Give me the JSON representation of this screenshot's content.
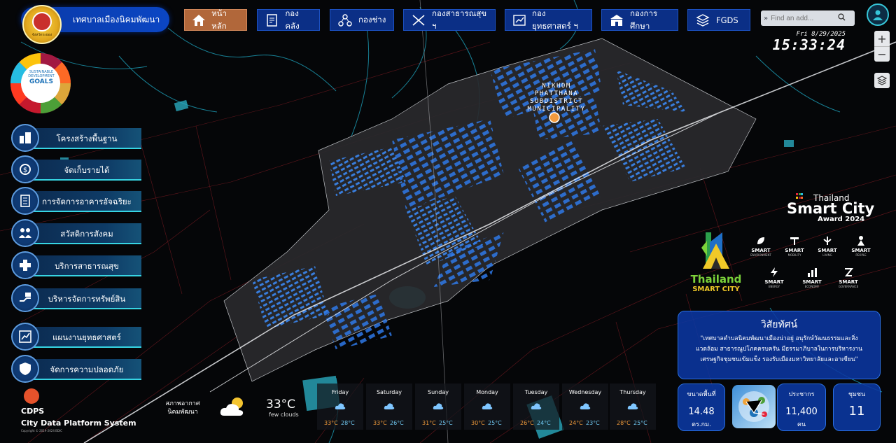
{
  "header": {
    "org_name": "เทศบาลเมืองนิคมพัฒนา",
    "logo_caption": "จังหวัดระยอง",
    "nav": [
      {
        "label": "หน้าหลัก",
        "icon": "home-icon",
        "active": true
      },
      {
        "label": "กองคลัง",
        "icon": "finance-icon",
        "active": false
      },
      {
        "label": "กองช่าง",
        "icon": "engineering-icon",
        "active": false
      },
      {
        "label": "กองสาธารณสุข ฯ",
        "icon": "health-icon",
        "active": false
      },
      {
        "label": "กองยุทธศาสตร์ ฯ",
        "icon": "strategy-icon",
        "active": false
      },
      {
        "label": "กองการศึกษา",
        "icon": "school-icon",
        "active": false
      },
      {
        "label": "FGDS",
        "icon": "layers-icon",
        "active": false
      }
    ],
    "search_placeholder": "Find an add...",
    "date": "Fri  8/29/2025",
    "time": "15:33:24"
  },
  "map": {
    "label_lines": [
      "NIKHOM",
      "PHATTHANA",
      "SUBDISTRICT",
      "MUNICIPALITY"
    ],
    "zoom_in": "+",
    "zoom_out": "−"
  },
  "sdg": {
    "line1": "SUSTAINABLE",
    "line2": "DEVELOPMENT",
    "line3": "GOALS"
  },
  "menu": [
    {
      "label": "โครงสร้างพื้นฐาน",
      "icon": "infrastructure-icon"
    },
    {
      "label": "จัดเก็บรายได้",
      "icon": "revenue-icon"
    },
    {
      "label": "การจัดการอาคารอัจฉริยะ",
      "icon": "smart-building-icon"
    },
    {
      "label": "สวัสดิการสังคม",
      "icon": "social-welfare-icon"
    },
    {
      "label": "บริการสาธารณสุข",
      "icon": "public-health-icon"
    },
    {
      "label": "บริหารจัดการทรัพย์สิน",
      "icon": "asset-management-icon"
    },
    {
      "label": "แผนงานยุทธศาสตร์",
      "icon": "strategic-plan-icon"
    },
    {
      "label": "จัดการความปลอดภัย",
      "icon": "safety-icon"
    }
  ],
  "footer": {
    "cdps": "CDPS",
    "cdps_full": "City Data Platform System",
    "copyright": "Copyright © 2019-2024 BDIC"
  },
  "weather": {
    "location": "สภาพอากาศ นิคมพัฒนา",
    "current_temp": "33°C",
    "description": "few clouds",
    "forecast": [
      {
        "day": "Friday",
        "hi": "33°C",
        "lo": "28°C"
      },
      {
        "day": "Saturday",
        "hi": "33°C",
        "lo": "26°C"
      },
      {
        "day": "Sunday",
        "hi": "31°C",
        "lo": "25°C"
      },
      {
        "day": "Monday",
        "hi": "30°C",
        "lo": "25°C"
      },
      {
        "day": "Tuesday",
        "hi": "26°C",
        "lo": "24°C"
      },
      {
        "day": "Wednesday",
        "hi": "24°C",
        "lo": "23°C"
      },
      {
        "day": "Thursday",
        "hi": "28°C",
        "lo": "25°C"
      }
    ]
  },
  "award": {
    "country": "Thailand",
    "title": "Smart City",
    "year_label": "Award 2024",
    "logo_line1": "Thailand",
    "logo_line2": "SMART CITY",
    "categories": [
      {
        "name": "SMART",
        "sub": "ENVIRONMENT"
      },
      {
        "name": "SMART",
        "sub": "MOBILITY"
      },
      {
        "name": "SMART",
        "sub": "LIVING"
      },
      {
        "name": "SMART",
        "sub": "PEOPLE"
      },
      {
        "name": "SMART",
        "sub": "ENERGY"
      },
      {
        "name": "SMART",
        "sub": "ECONOMY"
      },
      {
        "name": "SMART",
        "sub": "GOVERNANCE"
      }
    ]
  },
  "vision": {
    "title": "วิสัยทัศน์",
    "text": "\"เทศบาลตำบลนิคมพัฒนาเมืองน่าอยู่ อนุรักษ์วัฒนธรรมและสิ่งแวดล้อม สาธารณูปโภคครบครัน มีธรรมาภิบาลในการบริหารงาน เศรษฐกิจชุมชนเข้มแข็ง รองรับเมืองมหาวิทยาลัยและอาเซียน\""
  },
  "stats": {
    "area_label": "ขนาดพื้นที่",
    "area_value": "14.48",
    "area_unit": "ตร.กม.",
    "population_label": "ประชากร",
    "population_value": "11,400",
    "population_unit": "คน",
    "community_label": "ชุมชน",
    "community_value": "11"
  },
  "colors": {
    "nav_bg": "#0b2f86",
    "nav_active": "#b1673a",
    "accent_cyan": "#37d5e3",
    "panel_blue": "#0b37a0",
    "building_blue": "#2e78e6",
    "road_red": "#b3262e"
  }
}
